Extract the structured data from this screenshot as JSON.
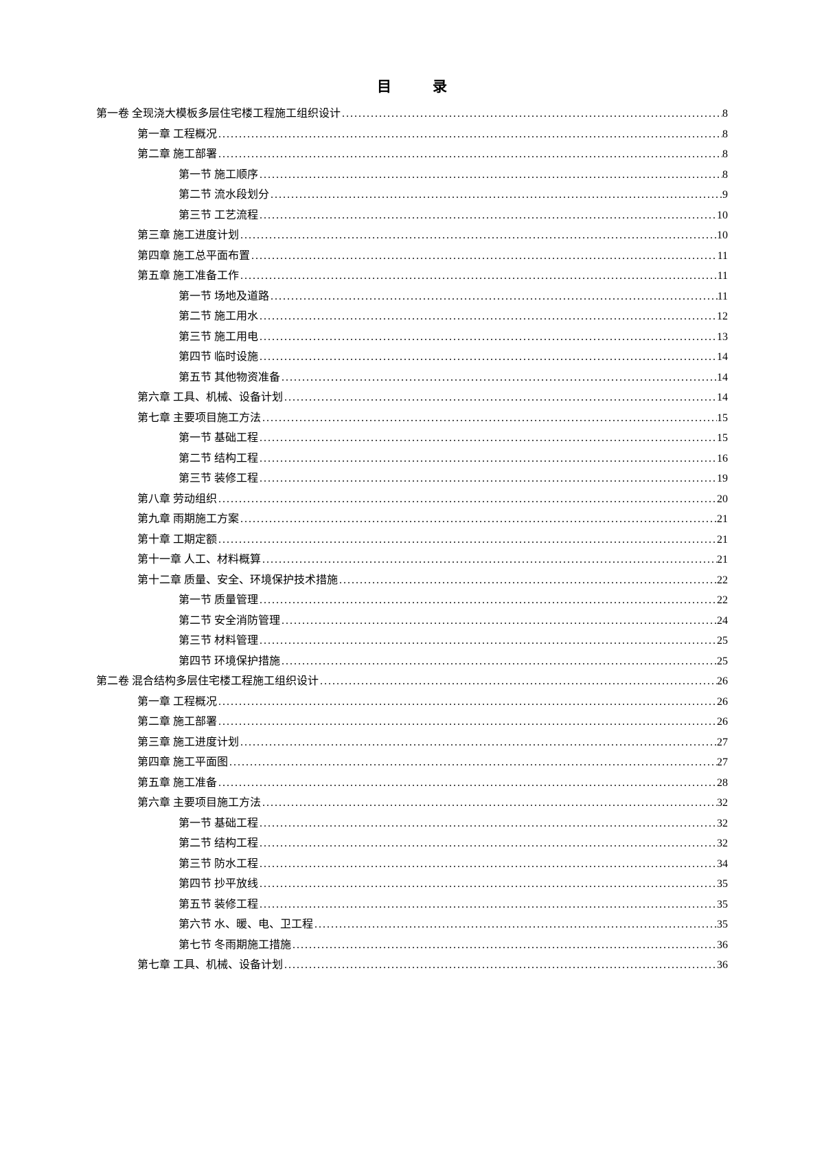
{
  "title": "目录",
  "toc": [
    {
      "level": 0,
      "label": "第一卷 全现浇大模板多层住宅楼工程施工组织设计",
      "page": "8"
    },
    {
      "level": 1,
      "label": "第一章 工程概况",
      "page": "8"
    },
    {
      "level": 1,
      "label": "第二章 施工部署",
      "page": "8"
    },
    {
      "level": 2,
      "label": "第一节 施工顺序",
      "page": "8"
    },
    {
      "level": 2,
      "label": "第二节 流水段划分",
      "page": "9"
    },
    {
      "level": 2,
      "label": "第三节 工艺流程",
      "page": "10"
    },
    {
      "level": 1,
      "label": "第三章 施工进度计划",
      "page": "10"
    },
    {
      "level": 1,
      "label": "第四章 施工总平面布置",
      "page": "11"
    },
    {
      "level": 1,
      "label": "第五章 施工准备工作",
      "page": "11"
    },
    {
      "level": 2,
      "label": "第一节 场地及道路",
      "page": "11"
    },
    {
      "level": 2,
      "label": "第二节 施工用水",
      "page": "12"
    },
    {
      "level": 2,
      "label": "第三节 施工用电",
      "page": "13"
    },
    {
      "level": 2,
      "label": "第四节 临时设施",
      "page": "14"
    },
    {
      "level": 2,
      "label": "第五节 其他物资准备",
      "page": "14"
    },
    {
      "level": 1,
      "label": "第六章 工具、机械、设备计划",
      "page": "14"
    },
    {
      "level": 1,
      "label": "第七章 主要项目施工方法",
      "page": "15"
    },
    {
      "level": 2,
      "label": "第一节 基础工程",
      "page": "15"
    },
    {
      "level": 2,
      "label": "第二节 结构工程",
      "page": "16"
    },
    {
      "level": 2,
      "label": "第三节 装修工程",
      "page": "19"
    },
    {
      "level": 1,
      "label": "第八章 劳动组织",
      "page": "20"
    },
    {
      "level": 1,
      "label": "第九章 雨期施工方案",
      "page": "21"
    },
    {
      "level": 1,
      "label": "第十章 工期定额",
      "page": "21"
    },
    {
      "level": 1,
      "label": "第十一章 人工、材料概算",
      "page": "21"
    },
    {
      "level": 1,
      "label": "第十二章 质量、安全、环境保护技术措施",
      "page": "22"
    },
    {
      "level": 2,
      "label": "第一节 质量管理",
      "page": "22"
    },
    {
      "level": 2,
      "label": "第二节 安全消防管理",
      "page": "24"
    },
    {
      "level": 2,
      "label": "第三节 材料管理",
      "page": "25"
    },
    {
      "level": 2,
      "label": "第四节 环境保护措施",
      "page": "25"
    },
    {
      "level": 0,
      "label": "第二卷 混合结构多层住宅楼工程施工组织设计",
      "page": "26"
    },
    {
      "level": 1,
      "label": "第一章 工程概况",
      "page": "26"
    },
    {
      "level": 1,
      "label": "第二章 施工部署",
      "page": "26"
    },
    {
      "level": 1,
      "label": "第三章 施工进度计划",
      "page": "27"
    },
    {
      "level": 1,
      "label": "第四章 施工平面图",
      "page": "27"
    },
    {
      "level": 1,
      "label": "第五章 施工准备",
      "page": "28"
    },
    {
      "level": 1,
      "label": "第六章 主要项目施工方法",
      "page": "32"
    },
    {
      "level": 2,
      "label": "第一节 基础工程",
      "page": "32"
    },
    {
      "level": 2,
      "label": "第二节 结构工程",
      "page": "32"
    },
    {
      "level": 2,
      "label": "第三节 防水工程",
      "page": "34"
    },
    {
      "level": 2,
      "label": "第四节 抄平放线",
      "page": "35"
    },
    {
      "level": 2,
      "label": "第五节 装修工程",
      "page": "35"
    },
    {
      "level": 2,
      "label": "第六节 水、暖、电、卫工程",
      "page": "35"
    },
    {
      "level": 2,
      "label": "第七节 冬雨期施工措施",
      "page": "36"
    },
    {
      "level": 1,
      "label": "第七章 工具、机械、设备计划",
      "page": "36"
    }
  ]
}
